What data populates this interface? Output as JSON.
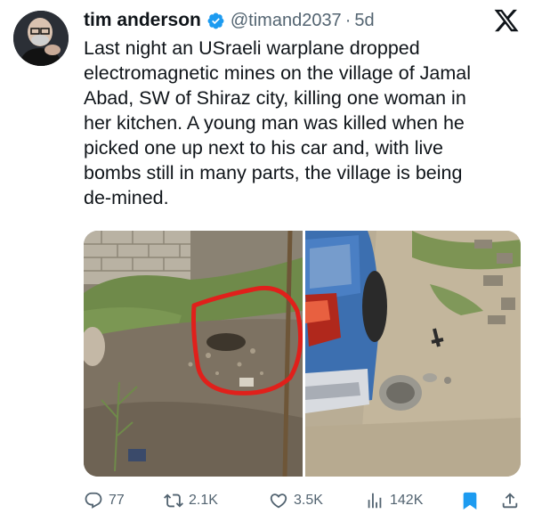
{
  "tweet": {
    "display_name": "tim anderson",
    "handle": "@timand2037",
    "separator": "·",
    "time": "5d",
    "text": "Last night an USraeli warplane dropped\nelectromagnetic mines on the village of Jamal\nAbad, SW of Shiraz city, killing one woman in\nher kitchen. A young man was killed when he\npicked one up next to his car and, with live\nbombs still in many parts, the village is being\nde-mined."
  },
  "icons": {
    "avatar": "avatar",
    "verified": "verified-badge-icon",
    "platform": "x-logo-icon",
    "reply": "reply-icon",
    "repost": "repost-icon",
    "like": "heart-icon",
    "views": "views-icon",
    "bookmark": "bookmark-icon",
    "share": "share-icon"
  },
  "actions": {
    "replies": "77",
    "reposts": "2.1K",
    "likes": "3.5K",
    "views": "142K"
  },
  "colors": {
    "accent": "#1d9bf0",
    "bookmark_active": "#1d9bf0",
    "muted": "#536471",
    "circle_annotation": "#e0201b"
  }
}
